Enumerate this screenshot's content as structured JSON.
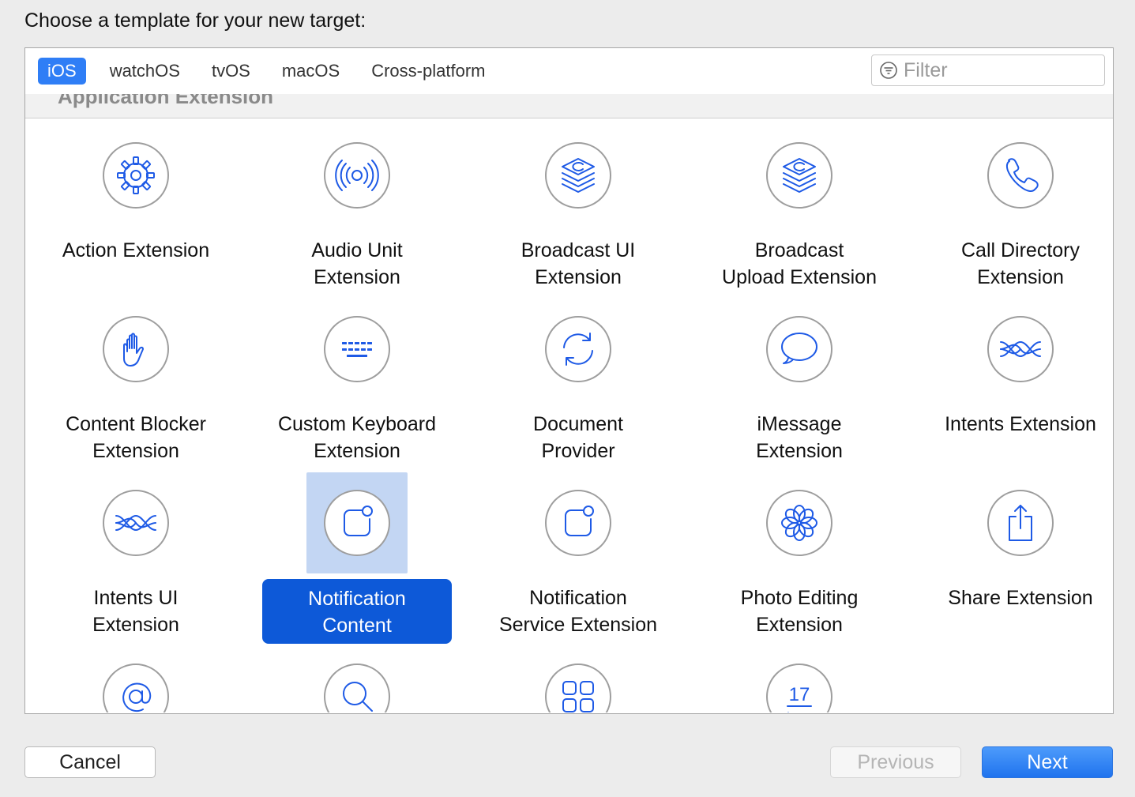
{
  "dialog": {
    "heading": "Choose a template for your new target:"
  },
  "platform_tabs": [
    {
      "label": "iOS",
      "selected": true
    },
    {
      "label": "watchOS",
      "selected": false
    },
    {
      "label": "tvOS",
      "selected": false
    },
    {
      "label": "macOS",
      "selected": false
    },
    {
      "label": "Cross-platform",
      "selected": false
    }
  ],
  "filter": {
    "placeholder": "Filter",
    "value": ""
  },
  "section": {
    "title": "Application Extension"
  },
  "templates": [
    {
      "name": "action-extension",
      "icon": "gear-icon",
      "lines": [
        "Action Extension"
      ],
      "selected": false
    },
    {
      "name": "audio-unit-extension",
      "icon": "audio-waves-icon",
      "lines": [
        "Audio Unit",
        "Extension"
      ],
      "selected": false
    },
    {
      "name": "broadcast-ui-extension",
      "icon": "broadcast-stack-icon",
      "lines": [
        "Broadcast UI",
        "Extension"
      ],
      "selected": false
    },
    {
      "name": "broadcast-upload-extension",
      "icon": "broadcast-stack-icon",
      "lines": [
        "Broadcast",
        "Upload Extension"
      ],
      "selected": false
    },
    {
      "name": "call-directory-extension",
      "icon": "phone-icon",
      "lines": [
        "Call Directory",
        "Extension"
      ],
      "selected": false
    },
    {
      "name": "content-blocker-extension",
      "icon": "hand-icon",
      "lines": [
        "Content Blocker",
        "Extension"
      ],
      "selected": false
    },
    {
      "name": "custom-keyboard-extension",
      "icon": "keyboard-icon",
      "lines": [
        "Custom Keyboard",
        "Extension"
      ],
      "selected": false
    },
    {
      "name": "document-provider",
      "icon": "sync-arrows-icon",
      "lines": [
        "Document",
        "Provider"
      ],
      "selected": false
    },
    {
      "name": "imessage-extension",
      "icon": "speech-bubble-icon",
      "lines": [
        "iMessage",
        "Extension"
      ],
      "selected": false
    },
    {
      "name": "intents-extension",
      "icon": "intents-waves-icon",
      "lines": [
        "Intents Extension"
      ],
      "selected": false
    },
    {
      "name": "intents-ui-extension",
      "icon": "intents-waves-icon",
      "lines": [
        "Intents UI",
        "Extension"
      ],
      "selected": false
    },
    {
      "name": "notification-content",
      "icon": "notification-badge-icon",
      "lines": [
        "Notification",
        "Content"
      ],
      "selected": true
    },
    {
      "name": "notification-service-extension",
      "icon": "notification-badge-icon",
      "lines": [
        "Notification",
        "Service Extension"
      ],
      "selected": false
    },
    {
      "name": "photo-editing-extension",
      "icon": "flower-icon",
      "lines": [
        "Photo Editing",
        "Extension"
      ],
      "selected": false
    },
    {
      "name": "share-extension",
      "icon": "share-icon",
      "lines": [
        "Share Extension"
      ],
      "selected": false
    },
    {
      "name": "at-sign-extension",
      "icon": "at-sign-icon",
      "lines": [],
      "selected": false
    },
    {
      "name": "spotlight-extension",
      "icon": "magnifier-icon",
      "lines": [],
      "selected": false
    },
    {
      "name": "sticker-pack-extension",
      "icon": "grid-squares-icon",
      "lines": [],
      "selected": false
    },
    {
      "name": "today-extension",
      "icon": "calendar-17-icon",
      "lines": [],
      "selected": false,
      "icon_text": "17"
    }
  ],
  "buttons": {
    "cancel": "Cancel",
    "previous": "Previous",
    "next": "Next"
  },
  "colors": {
    "accent": "#2f7ef6",
    "icon_blue": "#1e5ae6",
    "selection_label": "#0d59d8",
    "selection_icon_bg": "#c3d6f3"
  }
}
